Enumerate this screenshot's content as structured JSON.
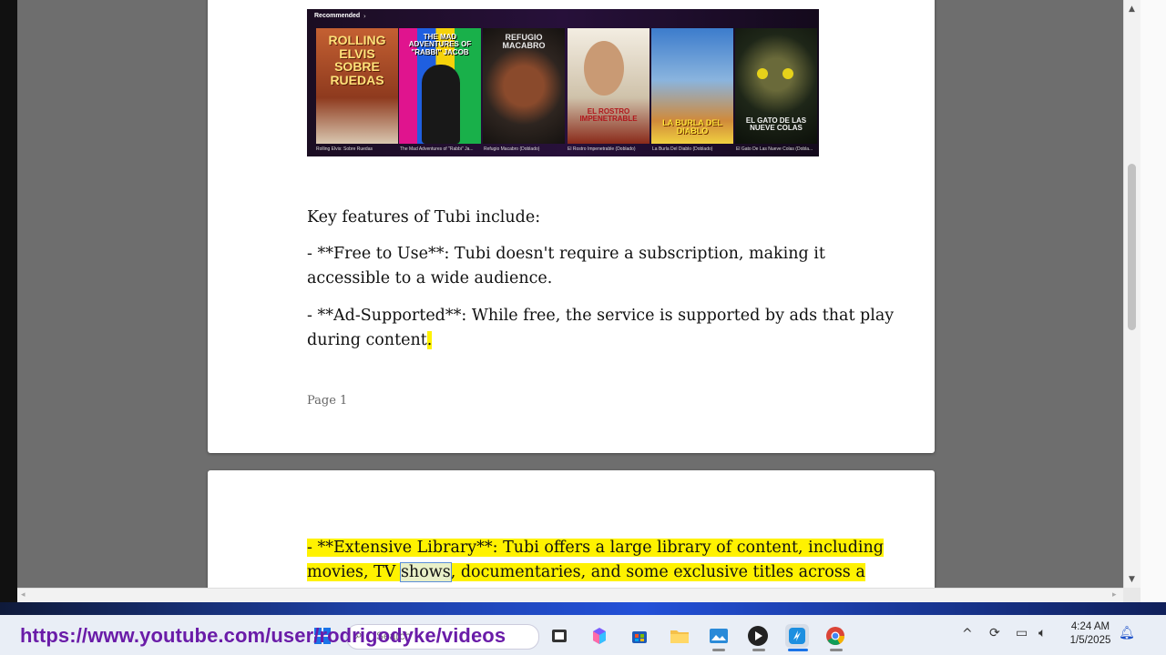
{
  "document": {
    "banner": {
      "title": "Recommended",
      "posters": [
        {
          "art_text": "ROLLING ELVIS SOBRE RUEDAS",
          "caption": "Rolling Elvis: Sobre Ruedas",
          "bg": "#b4502a"
        },
        {
          "art_text": "THE MAD ADVENTURES OF \"RABBI\" JACOB",
          "caption": "The Mad Adventures of \"Rabbi\" Ja...",
          "bg": "#d5169a"
        },
        {
          "art_text": "REFUGIO MACABRO",
          "caption": "Refugio Macabro (Doblado)",
          "bg": "#3a2a22"
        },
        {
          "art_text": "EL ROSTRO IMPENETRABLE",
          "caption": "El Rostro Impenetrable (Doblado)",
          "bg": "#e6dccd"
        },
        {
          "art_text": "LA BURLA DEL DIABLO",
          "caption": "La Burla Del Diablo (Doblado)",
          "bg": "#2a6cc0"
        },
        {
          "art_text": "EL GATO DE LAS NUEVE COLAS",
          "caption": "El Gato De Las Nueve Colas (Dobla...",
          "bg": "#1c2418"
        }
      ]
    },
    "page1": {
      "heading": "Key features of Tubi include:",
      "bullet1": "- **Free to Use**: Tubi doesn't require a subscription, making it accessible to a wide audience.",
      "bullet2_text": "- **Ad-Supported**: While free, the service is supported by ads that play during content",
      "bullet2_end": ".",
      "page_number": "Page 1"
    },
    "page2": {
      "line1": "- **Extensive Library**: Tubi offers a large library of content, including",
      "line2_before": "movies, TV ",
      "line2_selected": "shows",
      "line2_after": ", documentaries, and some exclusive titles across a"
    }
  },
  "scrollbar": {
    "up_arrow": "▲",
    "down_arrow": "▼",
    "left_arrow": "◂",
    "right_arrow": "▸"
  },
  "watermark": "https://www.youtube.com/user/rodrigodyke/videos",
  "taskbar": {
    "search_placeholder": "Search",
    "icons": [
      "windows-start-icon",
      "search-icon",
      "task-view-icon",
      "copilot-icon",
      "microsoft-store-icon",
      "file-explorer-icon",
      "photos-icon",
      "media-player-icon",
      "app-icon",
      "chrome-icon"
    ],
    "tray_icons": [
      "chevron-up-icon",
      "sync-icon",
      "network-icon",
      "volume-icon",
      "notification-bell-icon"
    ],
    "time": "4:24 AM",
    "date": "1/5/2025"
  }
}
